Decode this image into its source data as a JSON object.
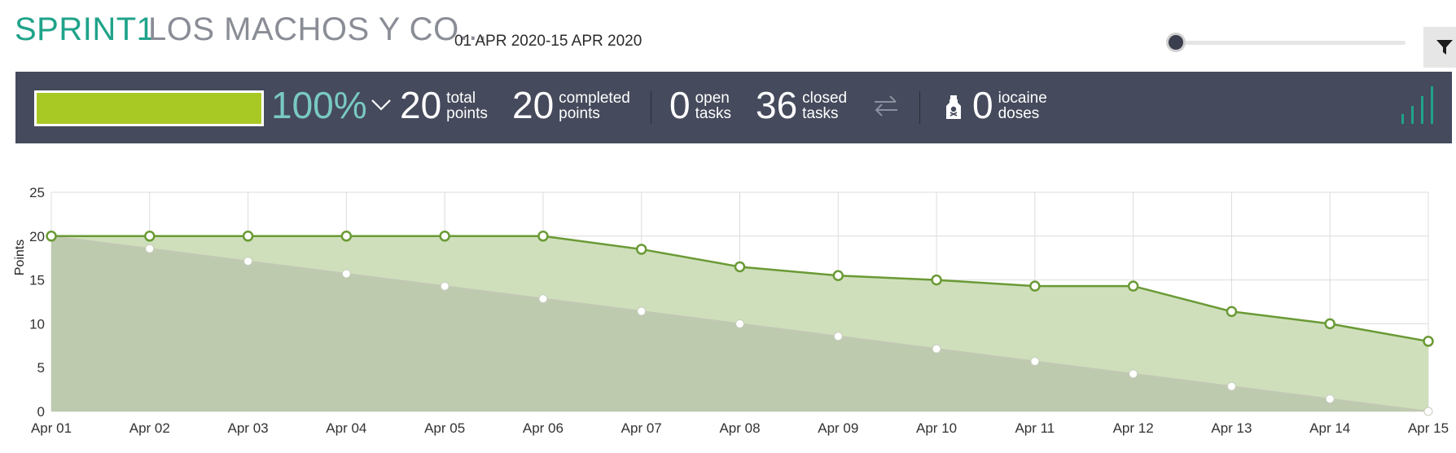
{
  "header": {
    "sprint_name": "SPRINT1",
    "project_name": "LOS MACHOS Y CO...",
    "dates": "01 APR 2020-15 APR 2020",
    "zoom_level": 0,
    "filter_icon": "filter-funnel"
  },
  "summary": {
    "progress_fraction": 1.0,
    "progress_color": "#a8c924",
    "percent": "100%",
    "total_points": {
      "value": "20",
      "label_1": "total",
      "label_2": "points"
    },
    "completed_points": {
      "value": "20",
      "label_1": "completed",
      "label_2": "points"
    },
    "open_tasks": {
      "value": "0",
      "label_1": "open",
      "label_2": "tasks"
    },
    "closed_tasks": {
      "value": "36",
      "label_1": "closed",
      "label_2": "tasks"
    },
    "iocaine_doses": {
      "value": "0",
      "label_1": "iocaine",
      "label_2": "doses"
    },
    "icons": [
      "chevron-down",
      "swap-arrows",
      "poison-bottle",
      "signal-bars"
    ]
  },
  "chart_data": {
    "type": "area",
    "ylabel": "Points",
    "xlabel": "",
    "ylim": [
      0,
      25
    ],
    "yticks": [
      0,
      5,
      10,
      15,
      20,
      25
    ],
    "categories": [
      "Apr 01",
      "Apr 02",
      "Apr 03",
      "Apr 04",
      "Apr 05",
      "Apr 06",
      "Apr 07",
      "Apr 08",
      "Apr 09",
      "Apr 10",
      "Apr 11",
      "Apr 12",
      "Apr 13",
      "Apr 14",
      "Apr 15"
    ],
    "grid": true,
    "series": [
      {
        "role": "actual",
        "color": "#6a9a35",
        "fill": "#cfdfbb",
        "values": [
          20,
          20,
          20,
          20,
          20,
          20,
          18.5,
          16.5,
          15.5,
          15,
          14.3,
          14.3,
          11.4,
          10,
          8
        ]
      },
      {
        "role": "ideal",
        "color": "#c2c8b4",
        "fill": "#bcc8ad",
        "values": [
          20,
          18.57,
          17.14,
          15.71,
          14.29,
          12.86,
          11.43,
          10,
          8.57,
          7.14,
          5.71,
          4.29,
          2.86,
          1.43,
          0
        ]
      }
    ]
  }
}
